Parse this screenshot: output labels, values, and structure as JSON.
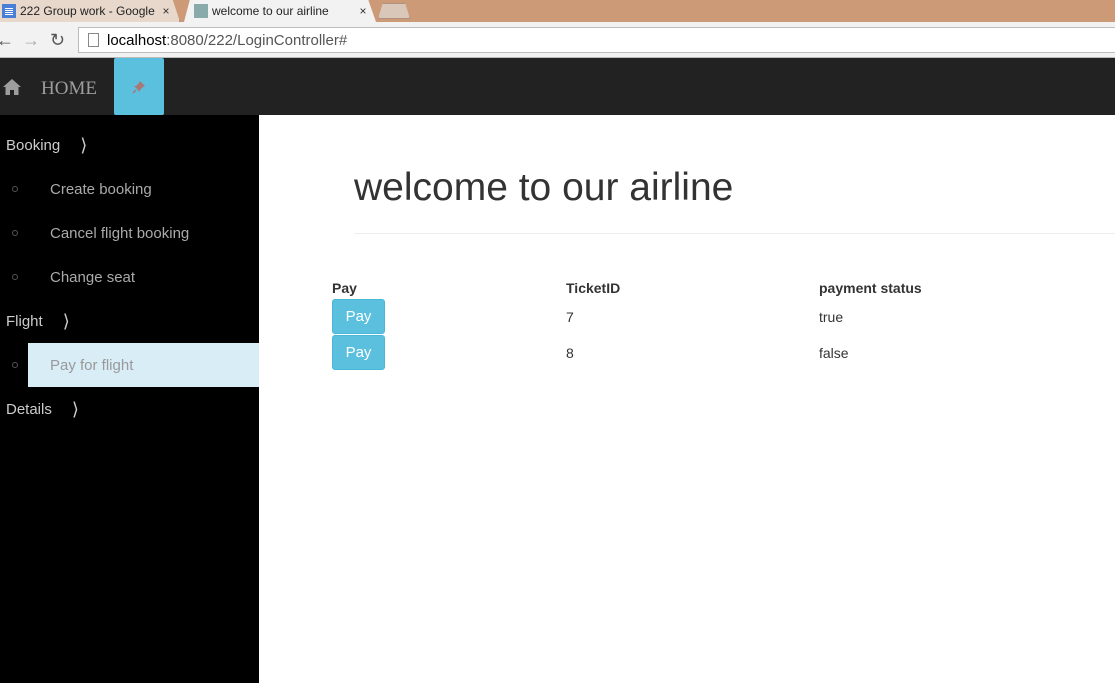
{
  "browser": {
    "tabs": [
      {
        "title": "222 Group work - Google",
        "close": "×"
      },
      {
        "title": "welcome to our airline",
        "close": "×"
      }
    ],
    "url_host": "localhost",
    "url_path": ":8080/222/LoginController#"
  },
  "header": {
    "home_label": "HOME",
    "icons": [
      "home-icon",
      "pin-icon"
    ],
    "accent_color": "#5bc0de"
  },
  "sidebar": {
    "sections": [
      {
        "label": "Booking",
        "items": [
          "Create booking",
          "Cancel flight booking",
          "Change seat"
        ]
      },
      {
        "label": "Flight",
        "items": [
          "Pay for flight"
        ]
      },
      {
        "label": "Details",
        "items": []
      }
    ],
    "active_item": "Pay for flight",
    "active_color": "#d9edf7"
  },
  "main": {
    "title": "welcome to our airline",
    "table": {
      "headers": [
        "Pay",
        "TicketID",
        "payment status"
      ],
      "rows": [
        {
          "pay": "Pay",
          "ticket_id": "7",
          "status": "true"
        },
        {
          "pay": "Pay",
          "ticket_id": "8",
          "status": "false"
        }
      ]
    }
  }
}
